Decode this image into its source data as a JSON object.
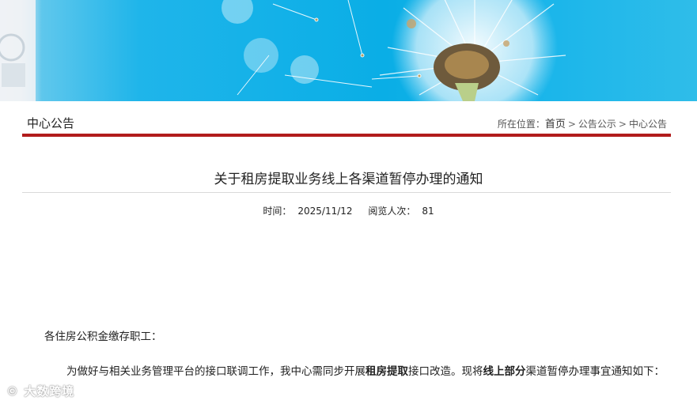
{
  "section": {
    "title": "中心公告"
  },
  "breadcrumb": {
    "prefix": "所在位置：",
    "home": "首页",
    "sep1": ">",
    "item1": "公告公示",
    "sep2": ">",
    "item2": "中心公告"
  },
  "article": {
    "title": "关于租房提取业务线上各渠道暂停办理的通知",
    "time_label": "时间：",
    "time_value": "2025/11/12",
    "views_label": "阅览人次：",
    "views_value": "81",
    "greeting": "各住房公积金缴存职工：",
    "para": {
      "t1": "为做好与相关业务管理平台的接口联调工作，我中心需同步开展",
      "b1": "租房提取",
      "t2": "接口改造。现将",
      "b2": "线上部分",
      "t3": "渠道暂停办理事宜通知如下："
    }
  },
  "watermark": {
    "text": "© 大数跨境"
  },
  "colors": {
    "accent_red": "#b11c1c",
    "banner_blue": "#0aaee6"
  }
}
